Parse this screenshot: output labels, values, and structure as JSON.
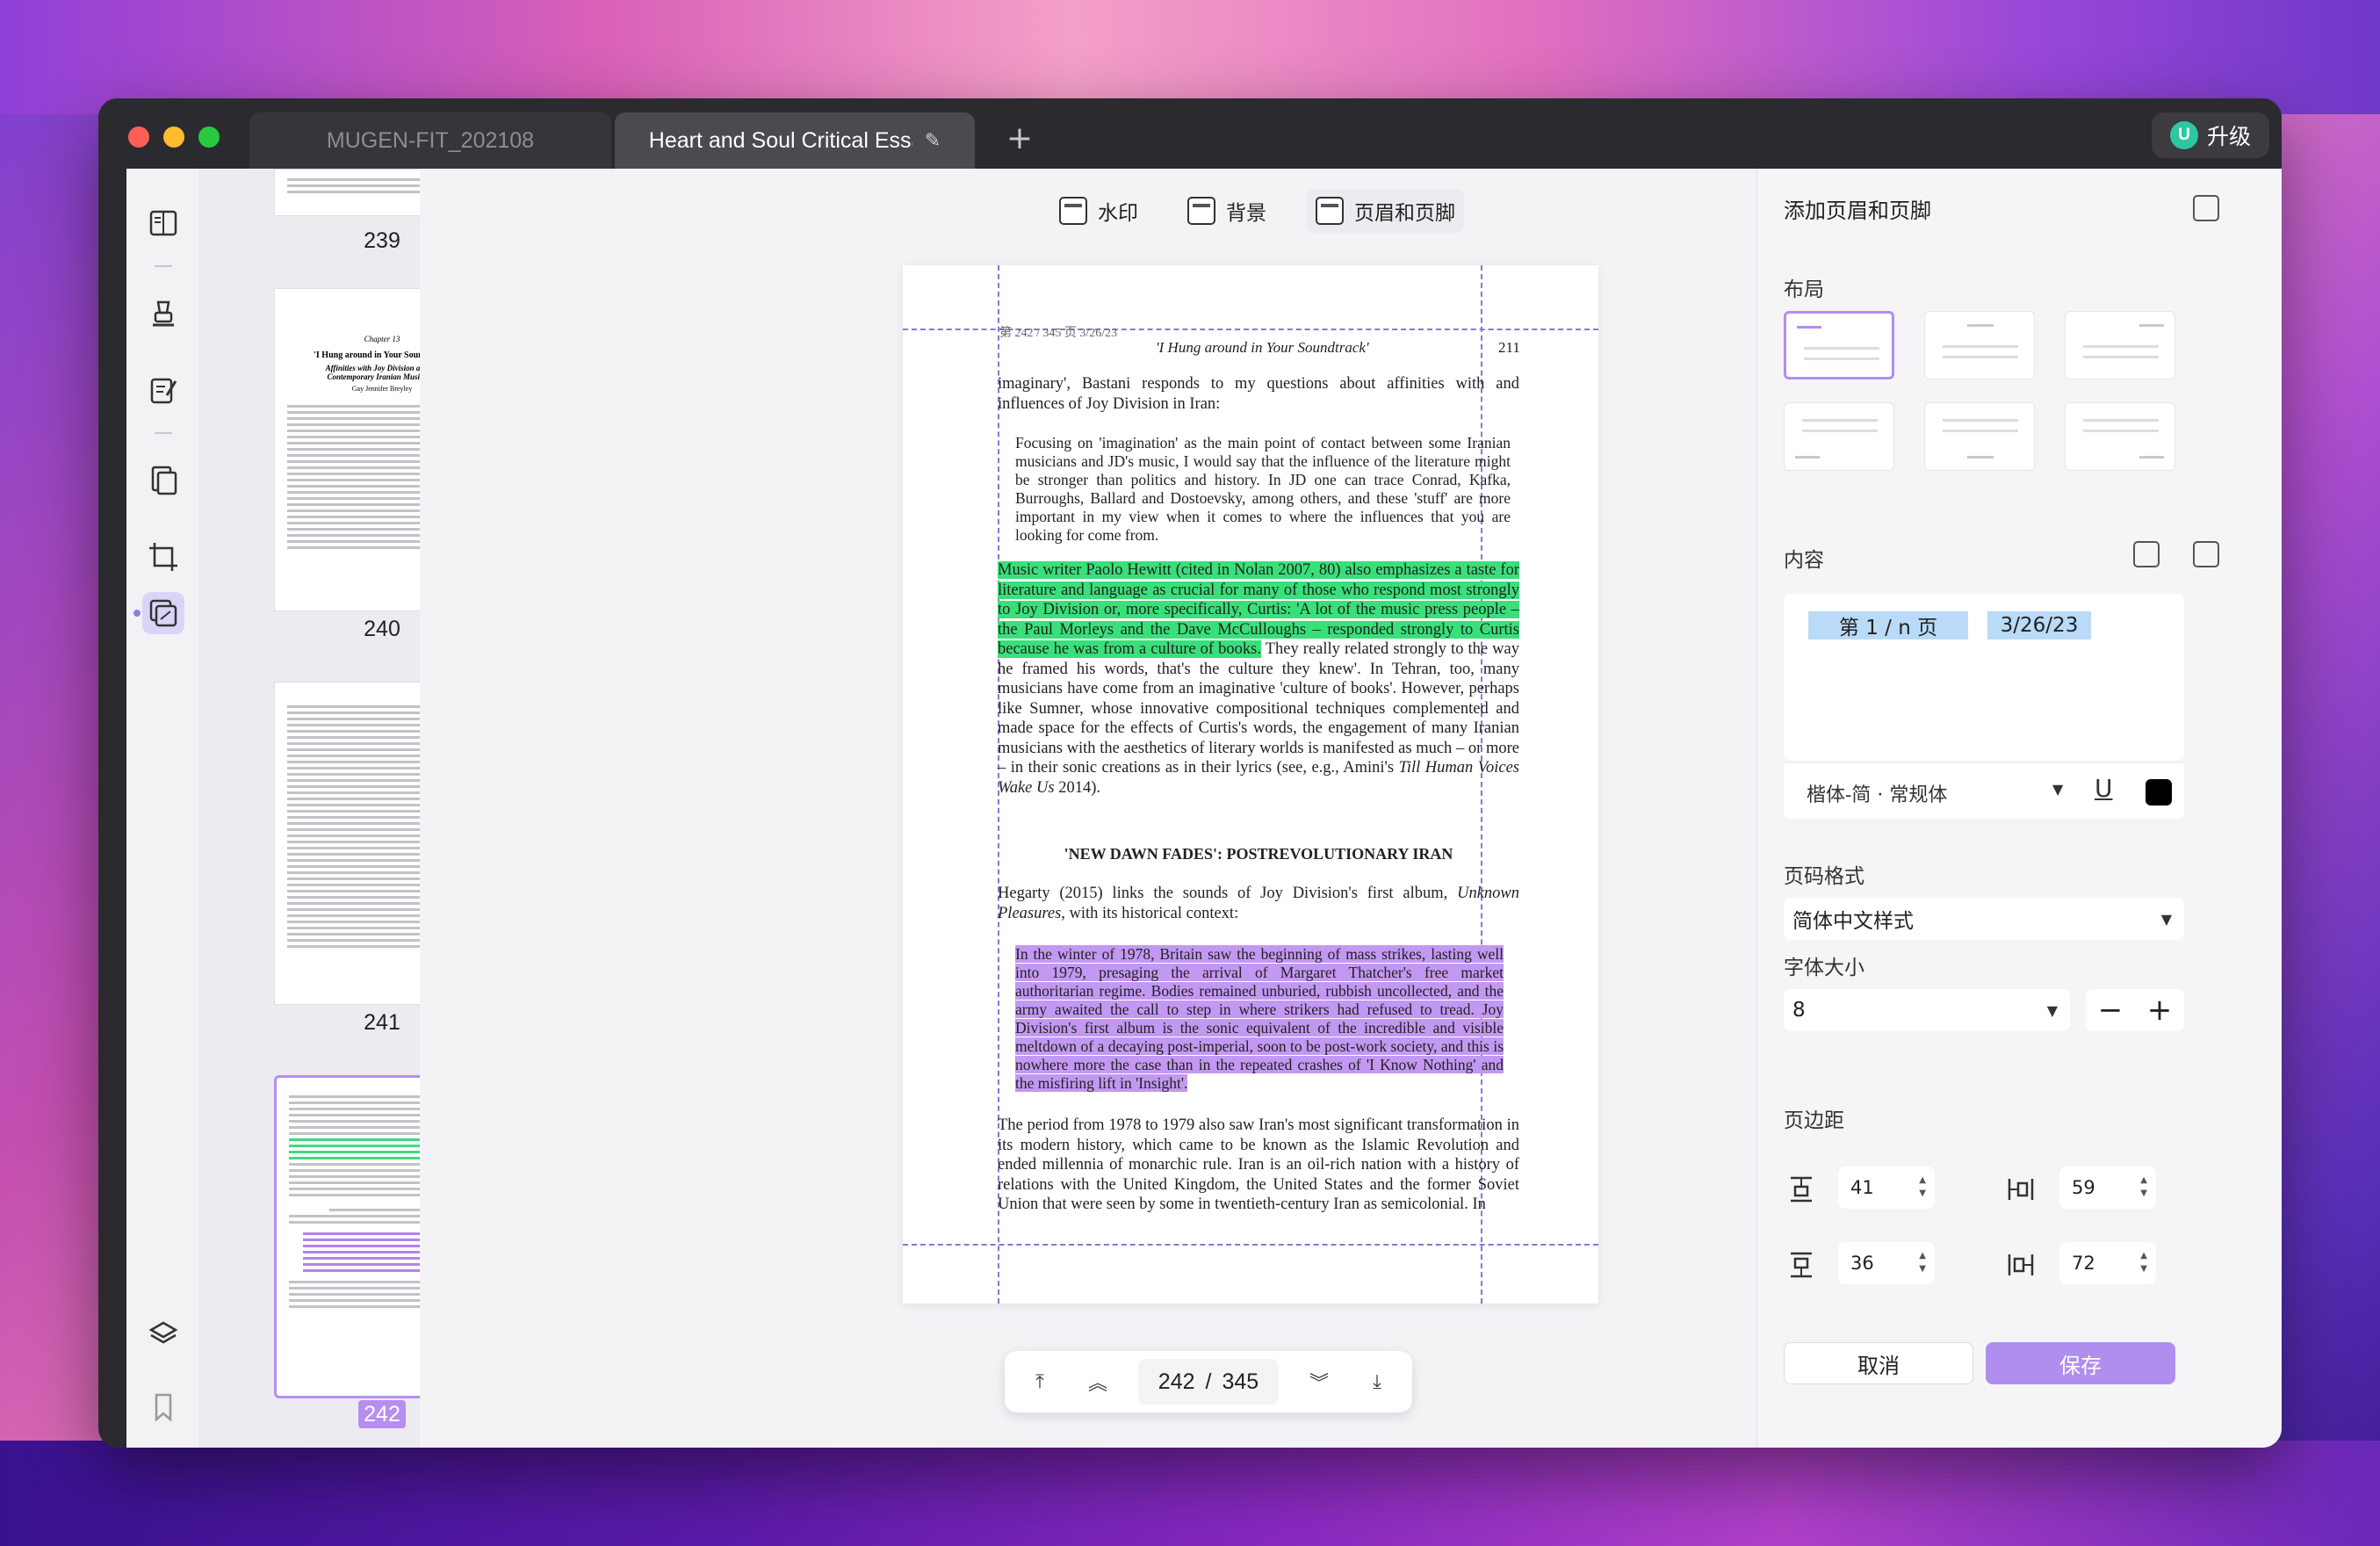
{
  "tabs": [
    {
      "label": "MUGEN-FIT_202108"
    },
    {
      "label": "Heart and Soul Critical Essays"
    }
  ],
  "upgrade": {
    "badge": "U",
    "label": "升级"
  },
  "thumbnails": [
    {
      "page": "239"
    },
    {
      "page": "240",
      "chapter": "Chapter 13",
      "title": "'I Hung around in Your Soundtrack'",
      "subtitle": "Affinities with Joy Division among Contemporary Iranian Musicians",
      "author": "Gay Jennifer Breyley"
    },
    {
      "page": "241"
    },
    {
      "page": "242"
    }
  ],
  "view_tools": {
    "watermark": "水印",
    "background": "背景",
    "header_footer": "页眉和页脚"
  },
  "page": {
    "stamp": "第 242 / 345 页 3/26/23",
    "running_head": "'I Hung around in Your Soundtrack'",
    "page_number": "211",
    "para1": "imaginary', Bastani responds to my questions about affinities with and influences of Joy Division in Iran:",
    "quote1": "Focusing on 'imagination' as the main point of contact between some Iranian musicians and JD's music, I would say that the influence of the literature might be stronger than politics and history. In JD one can trace Conrad, Kafka, Burroughs, Ballard and Dostoevsky, among others, and these 'stuff' are more important in my view when it comes to where the influences that you are looking for come from.",
    "para2_highlight": "Music writer Paolo Hewitt (cited in Nolan 2007, 80) also emphasizes a taste for literature and language as crucial for many of those who respond most strongly to Joy Division or, more specifically, Curtis: 'A lot of the music press people – the Paul Morleys and the Dave McCulloughs – responded strongly to Curtis because he was from a culture of books.",
    "para2_rest": " They really related strongly to the way he framed his words, that's the culture they knew'. In Tehran, too, many musicians have come from an imaginative 'culture of books'. However, perhaps like Sumner, whose innovative compositional techniques complemented and made space for the effects of Curtis's words, the engagement of many Iranian musicians with the aesthetics of literary worlds is manifested as much – or more – in their sonic creations as in their lyrics (see, e.g., Amini's ",
    "para2_title": "Till Human Voices Wake Us",
    "para2_end": " 2014).",
    "heading": "'NEW DAWN FADES': POSTREVOLUTIONARY IRAN",
    "para3_start": "Hegarty (2015) links the sounds of Joy Division's first album, ",
    "para3_title": "Unknown Pleasures",
    "para3_end": ", with its historical context:",
    "quote2": "In the winter of 1978, Britain saw the beginning of mass strikes, lasting well into 1979, presaging the arrival of Margaret Thatcher's free market authoritarian regime. Bodies remained unburied, rubbish uncollected, and the army awaited the call to step in where strikers had refused to tread. Joy Division's first album is the sonic equivalent of the incredible and visible meltdown of a decaying post-imperial, soon to be post-work society, and this is nowhere more the case than in the repeated crashes of 'I Know Nothing' and the misfiring lift in 'Insight'.",
    "para4": "The period from 1978 to 1979 also saw Iran's most significant transformation in its modern history, which came to be known as the Islamic Revolution and ended millennia of monarchic rule. Iran is an oil-rich nation with a history of relations with the United Kingdom, the United States and the former Soviet Union that were seen by some in twentieth-century Iran as semicolonial. In"
  },
  "pager": {
    "current": "242",
    "separator": "/",
    "total": "345"
  },
  "panel": {
    "title": "添加页眉和页脚",
    "layout_label": "布局",
    "content_label": "内容",
    "chip_page": "第 1 / n 页",
    "chip_date": "3/26/23",
    "font_name": "楷体-简 · 常规体",
    "underline": "U",
    "text_color": "#000000",
    "page_format_label": "页码格式",
    "page_format_value": "简体中文样式",
    "font_size_label": "字体大小",
    "font_size_value": "8",
    "margin_label": "页边距",
    "margin_top": "41",
    "margin_left": "59",
    "margin_bottom": "36",
    "margin_right": "72",
    "cancel": "取消",
    "save": "保存"
  },
  "colors": {
    "accent": "#b08ef0",
    "highlight_green": "#39e07a",
    "highlight_purple": "#c398f2"
  }
}
